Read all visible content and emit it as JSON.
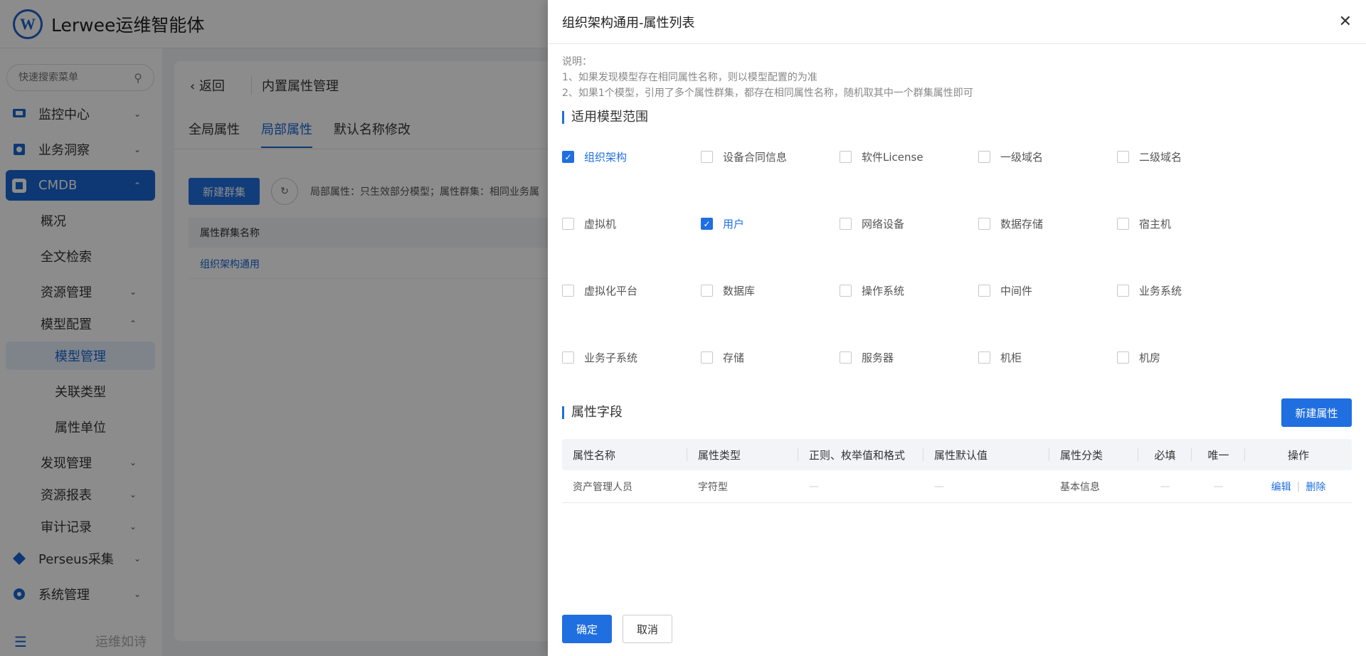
{
  "app": {
    "brand": "Lerwee运维智能体",
    "logo_letter": "W",
    "slogan": "运维如诗"
  },
  "sidebar": {
    "search_placeholder": "快速搜索菜单",
    "items": [
      {
        "label": "监控中心",
        "icon": "monitor-icon"
      },
      {
        "label": "业务洞察",
        "icon": "insight-icon"
      },
      {
        "label": "CMDB",
        "icon": "cmdb-icon"
      },
      {
        "label": "Perseus采集",
        "icon": "perseus-icon"
      },
      {
        "label": "系统管理",
        "icon": "gear-icon"
      }
    ],
    "cmdb_children": [
      "概况",
      "全文检索",
      "资源管理",
      "模型配置",
      "发现管理",
      "资源报表",
      "审计记录"
    ],
    "model_children": [
      "模型管理",
      "关联类型",
      "属性单位"
    ]
  },
  "page": {
    "back": "返回",
    "title": "内置属性管理",
    "tabs": [
      "全局属性",
      "局部属性",
      "默认名称修改"
    ],
    "new_group": "新建群集",
    "hint": "局部属性：只生效部分模型；属性群集：相同业务属",
    "table_header": "属性群集名称",
    "table_row": "组织架构通用"
  },
  "drawer": {
    "title": "组织架构通用-属性列表",
    "note_lines": [
      "说明：",
      "1、如果发现模型存在相同属性名称，则以模型配置的为准",
      "2、如果1个模型，引用了多个属性群集，都存在相同属性名称，随机取其中一个群集属性即可"
    ],
    "scope_title": "适用模型范围",
    "models": [
      {
        "label": "组织架构",
        "checked": true
      },
      {
        "label": "设备合同信息",
        "checked": false
      },
      {
        "label": "软件License",
        "checked": false
      },
      {
        "label": "一级域名",
        "checked": false
      },
      {
        "label": "二级域名",
        "checked": false
      },
      {
        "label": "虚拟机",
        "checked": false
      },
      {
        "label": "用户",
        "checked": true
      },
      {
        "label": "网络设备",
        "checked": false
      },
      {
        "label": "数据存储",
        "checked": false
      },
      {
        "label": "宿主机",
        "checked": false
      },
      {
        "label": "虚拟化平台",
        "checked": false
      },
      {
        "label": "数据库",
        "checked": false
      },
      {
        "label": "操作系统",
        "checked": false
      },
      {
        "label": "中间件",
        "checked": false
      },
      {
        "label": "业务系统",
        "checked": false
      },
      {
        "label": "业务子系统",
        "checked": false
      },
      {
        "label": "存储",
        "checked": false
      },
      {
        "label": "服务器",
        "checked": false
      },
      {
        "label": "机柜",
        "checked": false
      },
      {
        "label": "机房",
        "checked": false
      }
    ],
    "fields_title": "属性字段",
    "new_attr": "新建属性",
    "columns": [
      "属性名称",
      "属性类型",
      "正则、枚举值和格式",
      "属性默认值",
      "属性分类",
      "必填",
      "唯一",
      "操作"
    ],
    "rows": [
      {
        "name": "资产管理人员",
        "type": "字符型",
        "regex": "—",
        "default": "—",
        "category": "基本信息",
        "required": "—",
        "unique": "—",
        "edit": "编辑",
        "delete": "删除"
      }
    ],
    "ok": "确定",
    "cancel": "取消"
  },
  "colors": {
    "primary": "#1f6fe0",
    "mask": "rgba(0,0,0,0.45)"
  }
}
